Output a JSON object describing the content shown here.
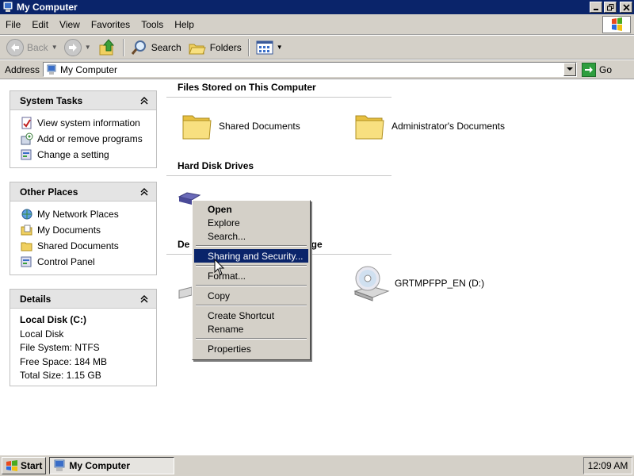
{
  "window": {
    "title": "My Computer"
  },
  "menubar": [
    "File",
    "Edit",
    "View",
    "Favorites",
    "Tools",
    "Help"
  ],
  "toolbar": {
    "back": "Back",
    "search": "Search",
    "folders": "Folders"
  },
  "address": {
    "label": "Address",
    "value": "My Computer",
    "go": "Go"
  },
  "system_tasks": {
    "title": "System Tasks",
    "items": [
      "View system information",
      "Add or remove programs",
      "Change a setting"
    ]
  },
  "other_places": {
    "title": "Other Places",
    "items": [
      "My Network Places",
      "My Documents",
      "Shared Documents",
      "Control Panel"
    ]
  },
  "details": {
    "title": "Details",
    "name": "Local Disk (C:)",
    "type": "Local Disk",
    "file_system": "File System: NTFS",
    "free_space": "Free Space: 184 MB",
    "total_size": "Total Size: 1.15 GB"
  },
  "sections": {
    "files_stored": "Files Stored on This Computer",
    "hard_disks": "Hard Disk Drives",
    "removable_prefix": "De",
    "removable_suffix": "age"
  },
  "items": {
    "shared_documents": "Shared Documents",
    "admin_documents": "Administrator's Documents",
    "cd_drive": "GRTMPFPP_EN (D:)"
  },
  "context_menu": {
    "open": "Open",
    "explore": "Explore",
    "search": "Search...",
    "sharing": "Sharing and Security...",
    "format": "Format...",
    "copy": "Copy",
    "create_shortcut": "Create Shortcut",
    "rename": "Rename",
    "properties": "Properties"
  },
  "taskbar": {
    "start": "Start",
    "window": "My Computer",
    "clock": "12:09 AM"
  },
  "colors": {
    "title_bar": "#0a246a",
    "highlight": "#0a246a",
    "chrome": "#d4d0c8"
  }
}
